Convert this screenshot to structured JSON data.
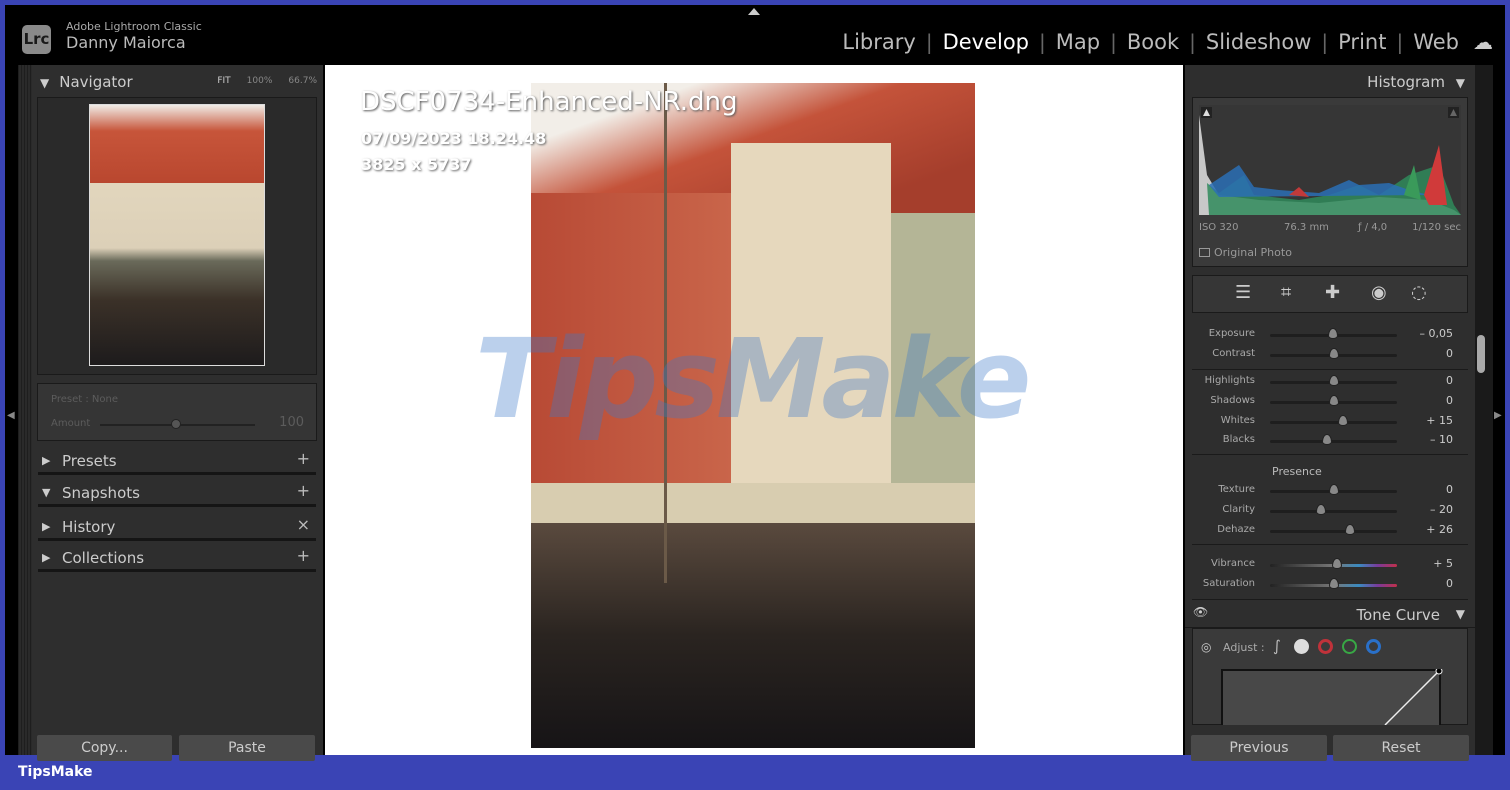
{
  "app": {
    "product": "Adobe Lightroom Classic",
    "user": "Danny Maiorca",
    "logo": "Lrc"
  },
  "modules": [
    {
      "label": "Library",
      "active": false
    },
    {
      "label": "Develop",
      "active": true
    },
    {
      "label": "Map",
      "active": false
    },
    {
      "label": "Book",
      "active": false
    },
    {
      "label": "Slideshow",
      "active": false
    },
    {
      "label": "Print",
      "active": false
    },
    {
      "label": "Web",
      "active": false
    }
  ],
  "left": {
    "navigator": {
      "title": "Navigator",
      "fit": "FIT",
      "z1": "100%",
      "z2": "66.7%"
    },
    "preset": {
      "label": "Preset : None",
      "amount_label": "Amount",
      "amount": "100",
      "amount_value": 100
    },
    "sections": [
      {
        "label": "Presets",
        "expanded": false,
        "action": "+"
      },
      {
        "label": "Snapshots",
        "expanded": true,
        "action": "+"
      },
      {
        "label": "History",
        "expanded": false,
        "action": "×"
      },
      {
        "label": "Collections",
        "expanded": false,
        "action": "+"
      }
    ],
    "copy": "Copy...",
    "paste": "Paste"
  },
  "image": {
    "filename": "DSCF0734-Enhanced-NR.dng",
    "datetime": "07/09/2023 18.24.48",
    "dimensions": "3825 x 5737",
    "watermark": "TipsMake"
  },
  "right": {
    "histogram": {
      "title": "Histogram",
      "iso": "ISO 320",
      "focal": "76.3 mm",
      "aperture": "ƒ / 4,0",
      "shutter": "1/120 sec",
      "original_photo": "Original Photo"
    },
    "tone": [
      {
        "name": "Exposure",
        "value": "– 0,05",
        "num": -0.05,
        "min": -5,
        "max": 5
      },
      {
        "name": "Contrast",
        "value": "0",
        "num": 0,
        "min": -100,
        "max": 100
      }
    ],
    "tone2": [
      {
        "name": "Highlights",
        "value": "0",
        "num": 0,
        "min": -100,
        "max": 100
      },
      {
        "name": "Shadows",
        "value": "0",
        "num": 0,
        "min": -100,
        "max": 100
      },
      {
        "name": "Whites",
        "value": "+ 15",
        "num": 15,
        "min": -100,
        "max": 100
      },
      {
        "name": "Blacks",
        "value": "– 10",
        "num": -10,
        "min": -100,
        "max": 100
      }
    ],
    "presence_label": "Presence",
    "presence": [
      {
        "name": "Texture",
        "value": "0",
        "num": 0,
        "min": -100,
        "max": 100
      },
      {
        "name": "Clarity",
        "value": "– 20",
        "num": -20,
        "min": -100,
        "max": 100
      },
      {
        "name": "Dehaze",
        "value": "+ 26",
        "num": 26,
        "min": -100,
        "max": 100
      }
    ],
    "color": [
      {
        "name": "Vibrance",
        "value": "+ 5",
        "num": 5,
        "min": -100,
        "max": 100
      },
      {
        "name": "Saturation",
        "value": "0",
        "num": 0,
        "min": -100,
        "max": 100
      }
    ],
    "tone_curve": {
      "title": "Tone Curve",
      "adjust": "Adjust :"
    },
    "previous": "Previous",
    "reset": "Reset"
  },
  "footer": {
    "brand": "TipsMake"
  }
}
